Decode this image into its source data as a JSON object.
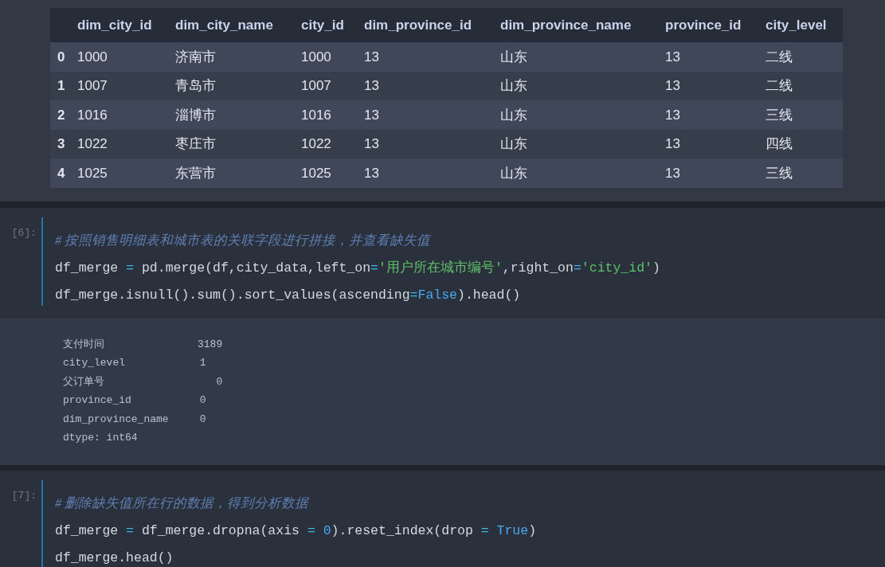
{
  "table": {
    "columns": [
      "dim_city_id",
      "dim_city_name",
      "city_id",
      "dim_province_id",
      "dim_province_name",
      "province_id",
      "city_level"
    ],
    "rows": [
      {
        "index": "0",
        "cells": [
          "1000",
          "济南市",
          "1000",
          "13",
          "山东",
          "13",
          "二线"
        ]
      },
      {
        "index": "1",
        "cells": [
          "1007",
          "青岛市",
          "1007",
          "13",
          "山东",
          "13",
          "二线"
        ]
      },
      {
        "index": "2",
        "cells": [
          "1016",
          "淄博市",
          "1016",
          "13",
          "山东",
          "13",
          "三线"
        ]
      },
      {
        "index": "3",
        "cells": [
          "1022",
          "枣庄市",
          "1022",
          "13",
          "山东",
          "13",
          "四线"
        ]
      },
      {
        "index": "4",
        "cells": [
          "1025",
          "东营市",
          "1025",
          "13",
          "山东",
          "13",
          "三线"
        ]
      }
    ]
  },
  "cells": [
    {
      "prompt": "[6]:",
      "lines": [
        [
          {
            "kind": "comment",
            "text": "# 按照销售明细表和城市表的关联字段进行拼接，并查看缺失值"
          }
        ],
        [
          {
            "kind": "plain",
            "text": "df_merge "
          },
          {
            "kind": "op",
            "text": "="
          },
          {
            "kind": "plain",
            "text": " pd.merge(df,city_data,left_on"
          },
          {
            "kind": "op",
            "text": "="
          },
          {
            "kind": "string",
            "text": "'用户所在城市编号'"
          },
          {
            "kind": "plain",
            "text": ",right_on"
          },
          {
            "kind": "op",
            "text": "="
          },
          {
            "kind": "string",
            "text": "'city_id'"
          },
          {
            "kind": "plain",
            "text": ")"
          }
        ],
        [
          {
            "kind": "plain",
            "text": "df_merge.isnull().sum().sort_values(ascending"
          },
          {
            "kind": "op",
            "text": "="
          },
          {
            "kind": "keyword",
            "text": "False"
          },
          {
            "kind": "plain",
            "text": ").head()"
          }
        ]
      ],
      "output": [
        "支付时间               3189",
        "city_level            1",
        "父订单号                  0",
        "province_id           0",
        "dim_province_name     0",
        "dtype: int64"
      ]
    },
    {
      "prompt": "[7]:",
      "lines": [
        [
          {
            "kind": "comment",
            "text": "# 删除缺失值所在行的数据，得到分析数据"
          }
        ],
        [
          {
            "kind": "plain",
            "text": "df_merge"
          },
          {
            "kind": "op",
            "text": " = "
          },
          {
            "kind": "plain",
            "text": "df_merge.dropna(axis"
          },
          {
            "kind": "op",
            "text": " = "
          },
          {
            "kind": "keyword",
            "text": "0"
          },
          {
            "kind": "plain",
            "text": ").reset_index(drop"
          },
          {
            "kind": "op",
            "text": " = "
          },
          {
            "kind": "keyword",
            "text": "True"
          },
          {
            "kind": "plain",
            "text": ")"
          }
        ],
        [
          {
            "kind": "plain",
            "text": "df_merge.head()"
          }
        ]
      ]
    }
  ]
}
